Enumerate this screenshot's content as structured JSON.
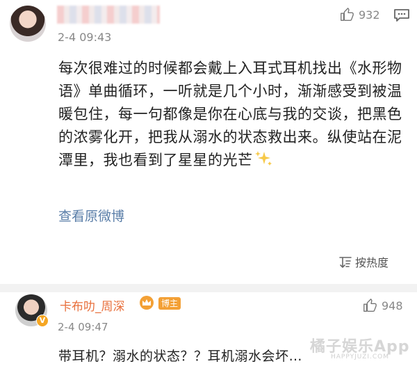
{
  "comment1": {
    "time": "2-4 09:43",
    "likes": "932",
    "body": "每次很难过的时候都会戴上入耳式耳机找出《水形物语》单曲循环，一听就是几个小时，渐渐感受到被温暖包住，每一句都像是你在心底与我的交谈，把黑色的浓雾化开，把我从溺水的状态救出来。纵使站在泥潭里，我也看到了星星的光芒",
    "view_original": "查看原微博"
  },
  "sort": {
    "label": "按热度"
  },
  "comment2": {
    "username": "卡布叻_周深",
    "badge": "博主",
    "time": "2-4 09:47",
    "likes": "948",
    "body": "带耳机？溺水的状态？？耳机溺水会坏…"
  },
  "watermark": {
    "main": "橘子娱乐App",
    "sub": "HAPPYJUZI.COM"
  },
  "colors": {
    "link": "#5a7ea8",
    "username_orange": "#e86f3b",
    "badge_orange": "#f3a035",
    "divider": "#f2f2f2"
  }
}
